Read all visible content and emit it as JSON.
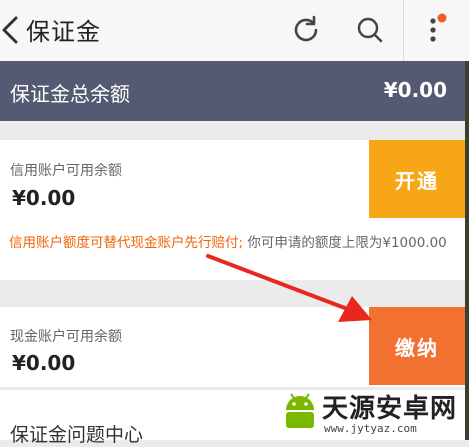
{
  "header": {
    "title": "保证金",
    "icons": [
      "back-icon",
      "refresh-icon",
      "search-icon",
      "more-icon"
    ]
  },
  "summary": {
    "label": "保证金总余额",
    "value": "¥0.00"
  },
  "credit": {
    "label": "信用账户可用余额",
    "amount": "¥0.00",
    "button": "开通",
    "note_highlight": "信用账户额度可替代现金账户先行赔付;",
    "note_rest": " 你可申请的额度上限为¥1000.00"
  },
  "cash": {
    "label": "现金账户可用余额",
    "amount": "¥0.00",
    "button": "缴纳"
  },
  "faq": {
    "label": "保证金问题中心"
  },
  "watermark": {
    "title": "天源安卓网",
    "url": "www.jytyaz.com"
  },
  "colors": {
    "summary_bg": "#535a72",
    "open_button": "#f7a617",
    "pay_button": "#f27130",
    "highlight": "#f0650c",
    "arrow": "#e8281f",
    "notification_dot": "#f05a28"
  }
}
